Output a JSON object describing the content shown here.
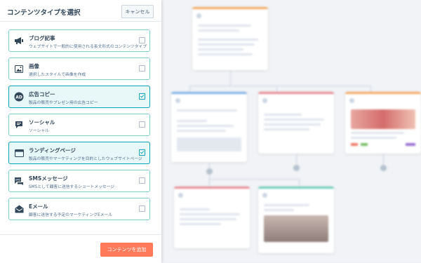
{
  "panel": {
    "title": "コンテンツタイプを選択",
    "cancel_label": "キャンセル",
    "add_label": "コンテンツを追加"
  },
  "options": [
    {
      "name": "ブログ記事",
      "desc": "ウェブサイトで一般的に使用される長文形式のコンテンツタイプ",
      "icon": "megaphone-icon",
      "selected": false
    },
    {
      "name": "画像",
      "desc": "選択したスタイルで画像を作成",
      "icon": "image-icon",
      "selected": false
    },
    {
      "name": "広告コピー",
      "desc": "製品の販売やプレゼン用の広告コピー",
      "icon": "ad-icon",
      "selected": true
    },
    {
      "name": "ソーシャル",
      "desc": "ソーシャル",
      "icon": "chat-bubble-icon",
      "selected": false
    },
    {
      "name": "ランディングページ",
      "desc": "製品の販売やマーケティングを目的としたウェブサイトページ",
      "icon": "browser-window-icon",
      "selected": true
    },
    {
      "name": "SMSメッセージ",
      "desc": "SMSとして顧客に送信するショートメッセージ",
      "icon": "sms-icon",
      "selected": false
    },
    {
      "name": "Eメール",
      "desc": "顧客に送信する予定のマーケティングEメール",
      "icon": "email-icon",
      "selected": false
    }
  ],
  "colors": {
    "accent": "#00a4bd",
    "option_border": "#7fd1cf",
    "selected_bg": "#e8f7f8",
    "primary_button": "#ff7a59",
    "card_orange": "#f5a962",
    "card_blue": "#7fb0e6",
    "card_red": "#e58a94",
    "card_teal": "#6ccbb8"
  }
}
